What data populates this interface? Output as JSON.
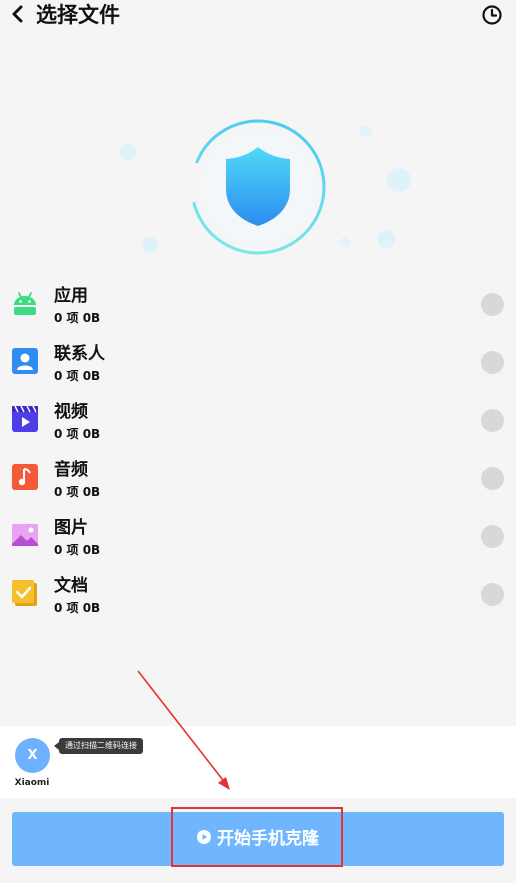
{
  "header": {
    "title": "选择文件",
    "back_icon": "chevron-left-icon",
    "history_icon": "clock-icon"
  },
  "hero": {
    "icon": "shield-icon",
    "accent_color": "#40c8f5"
  },
  "items": [
    {
      "name": "应用",
      "meta": "0 项 0B",
      "icon": "android-icon",
      "color": "#3ddc84"
    },
    {
      "name": "联系人",
      "meta": "0 项 0B",
      "icon": "contact-icon",
      "color": "#2f8cf0"
    },
    {
      "name": "视频",
      "meta": "0 项 0B",
      "icon": "video-icon",
      "color": "#4f3ee8"
    },
    {
      "name": "音频",
      "meta": "0 项 0B",
      "icon": "music-icon",
      "color": "#f25a3a"
    },
    {
      "name": "图片",
      "meta": "0 项 0B",
      "icon": "image-icon",
      "color": "#d07be8"
    },
    {
      "name": "文档",
      "meta": "0 项 0B",
      "icon": "document-icon",
      "color": "#f5c02a"
    }
  ],
  "device": {
    "avatar_letter": "X",
    "name": "Xiaomi",
    "tip": "通过扫描二维码连接"
  },
  "start_button": {
    "label": "开始手机克隆",
    "color": "#6fb6ff"
  },
  "annotation": {
    "color": "#e3342f"
  }
}
